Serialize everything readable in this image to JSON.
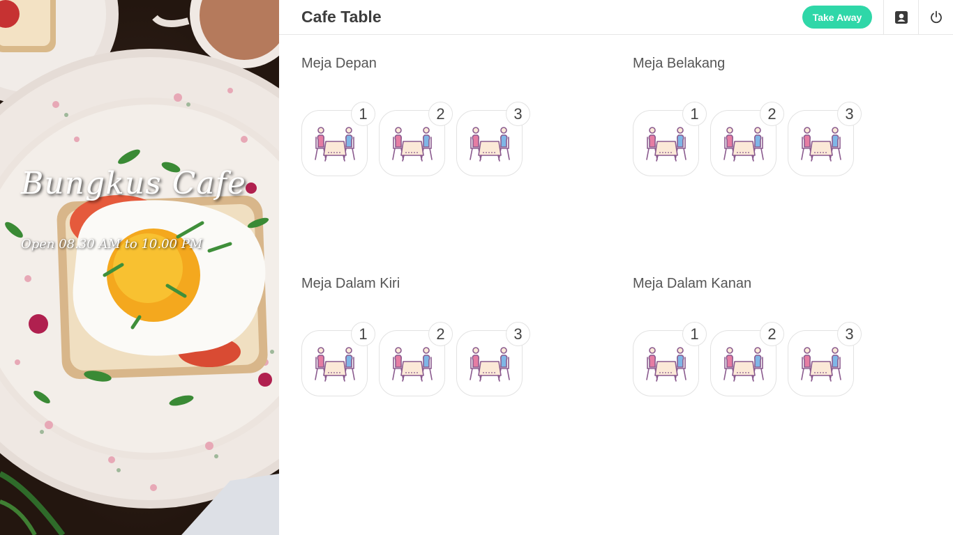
{
  "hero": {
    "title": "Bungkus Cafe",
    "hours": "Open 08.30 AM to 10.00 PM"
  },
  "header": {
    "title": "Cafe Table",
    "takeaway_label": "Take Away",
    "icons": [
      "profile-card-icon",
      "power-icon"
    ]
  },
  "sections": [
    {
      "title": "Meja Depan",
      "tables": [
        "1",
        "2",
        "3"
      ]
    },
    {
      "title": "Meja Belakang",
      "tables": [
        "1",
        "2",
        "3"
      ]
    },
    {
      "title": "Meja Dalam Kiri",
      "tables": [
        "1",
        "2",
        "3"
      ]
    },
    {
      "title": "Meja Dalam Kanan",
      "tables": [
        "1",
        "2",
        "3"
      ]
    }
  ],
  "colors": {
    "accent": "#2fd7a8",
    "chair_pink": "#e57da3",
    "chair_blue": "#7fb6e6",
    "table_top": "#fbe9d7",
    "outline": "#8a5a8e"
  }
}
